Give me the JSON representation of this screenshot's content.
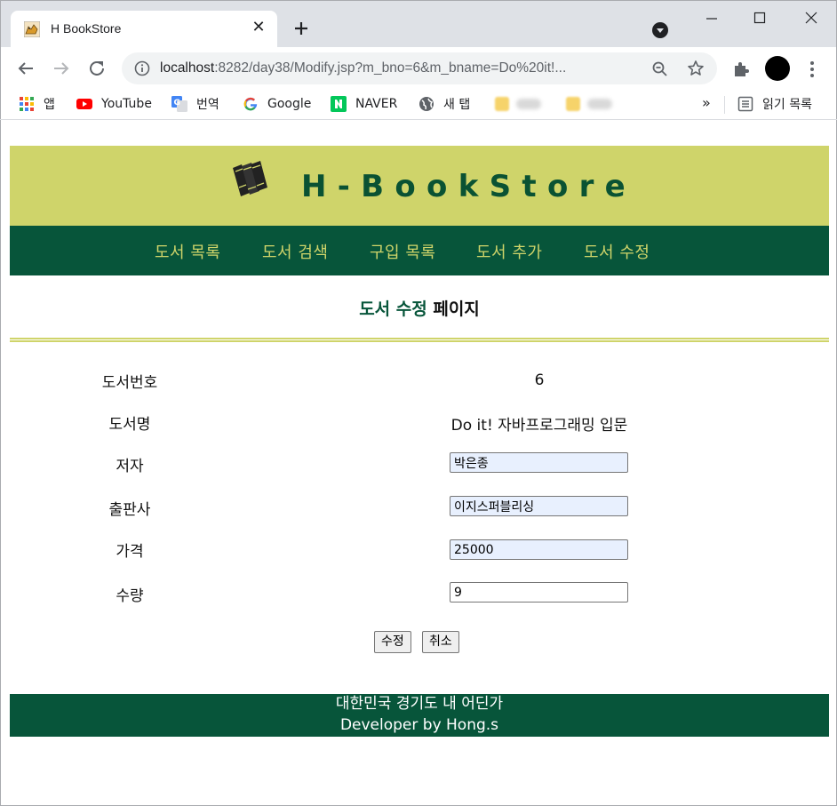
{
  "browser": {
    "tab_title": "H BookStore",
    "tab_close": "✕",
    "url_host": "localhost",
    "url_rest": ":8282/day38/Modify.jsp?m_bno=6&m_bname=Do%20it!...",
    "bookmarks": [
      {
        "label": "앱",
        "icon": "apps-grid-icon"
      },
      {
        "label": "YouTube",
        "icon": "youtube-icon"
      },
      {
        "label": "번역",
        "icon": "translate-icon"
      },
      {
        "label": "Google",
        "icon": "google-icon"
      },
      {
        "label": "NAVER",
        "icon": "naver-icon"
      },
      {
        "label": "새 탭",
        "icon": "globe-icon"
      }
    ],
    "bookmarks_more": "»",
    "reading_list": "읽기 목록"
  },
  "header": {
    "brand": "H-BookStore"
  },
  "nav": {
    "items": [
      "도서 목록",
      "도서 검색",
      "구입 목록",
      "도서 추가",
      "도서 수정"
    ]
  },
  "page": {
    "title_accent": "도서 수정",
    "title_rest": " 페이지"
  },
  "form": {
    "labels": {
      "bno": "도서번호",
      "bname": "도서명",
      "author": "저자",
      "publisher": "출판사",
      "price": "가격",
      "qty": "수량"
    },
    "values": {
      "bno": "6",
      "bname": "Do it! 자바프로그래밍 입문",
      "author": "박은종",
      "publisher": "이지스퍼블리싱",
      "price": "25000",
      "qty": "9"
    },
    "submit_label": "수정",
    "cancel_label": "취소"
  },
  "footer": {
    "line1": "대한민국 경기도 내 어딘가",
    "line2": "Developer by Hong.s"
  },
  "colors": {
    "header_bg": "#cfd46a",
    "nav_bg": "#07553a",
    "brand_text": "#0a5233",
    "nav_text": "#cfd46a",
    "autofill_bg": "#e8f0fe"
  }
}
